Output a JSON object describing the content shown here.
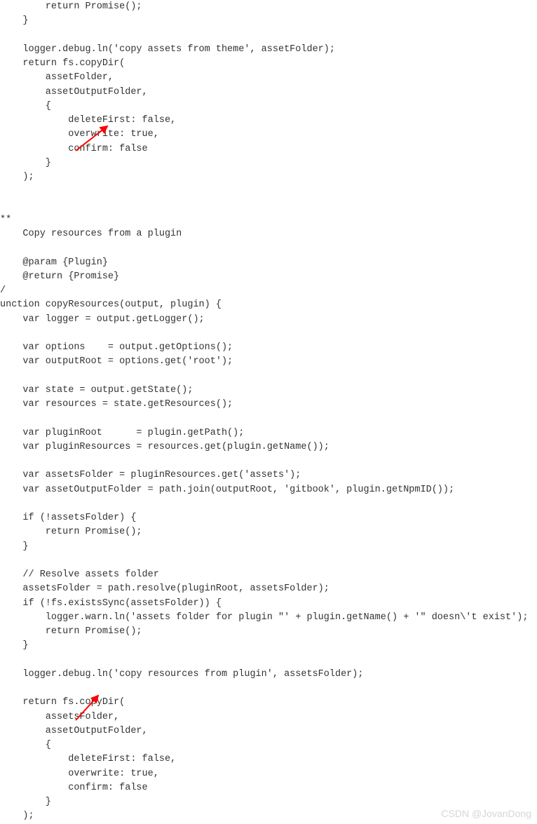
{
  "code": {
    "lines": [
      "        return Promise();",
      "    }",
      "",
      "    logger.debug.ln('copy assets from theme', assetFolder);",
      "    return fs.copyDir(",
      "        assetFolder,",
      "        assetOutputFolder,",
      "        {",
      "            deleteFirst: false,",
      "            overwrite: true,",
      "            confirm: false",
      "        }",
      "    );",
      "",
      "",
      "**",
      "    Copy resources from a plugin",
      "",
      "    @param {Plugin}",
      "    @return {Promise}",
      "/",
      "unction copyResources(output, plugin) {",
      "    var logger = output.getLogger();",
      "",
      "    var options    = output.getOptions();",
      "    var outputRoot = options.get('root');",
      "",
      "    var state = output.getState();",
      "    var resources = state.getResources();",
      "",
      "    var pluginRoot      = plugin.getPath();",
      "    var pluginResources = resources.get(plugin.getName());",
      "",
      "    var assetsFolder = pluginResources.get('assets');",
      "    var assetOutputFolder = path.join(outputRoot, 'gitbook', plugin.getNpmID());",
      "",
      "    if (!assetsFolder) {",
      "        return Promise();",
      "    }",
      "",
      "    // Resolve assets folder",
      "    assetsFolder = path.resolve(pluginRoot, assetsFolder);",
      "    if (!fs.existsSync(assetsFolder)) {",
      "        logger.warn.ln('assets folder for plugin \"' + plugin.getName() + '\" doesn\\'t exist');",
      "        return Promise();",
      "    }",
      "",
      "    logger.debug.ln('copy resources from plugin', assetsFolder);",
      "",
      "    return fs.copyDir(",
      "        assetsFolder,",
      "        assetOutputFolder,",
      "        {",
      "            deleteFirst: false,",
      "            overwrite: true,",
      "            confirm: false",
      "        }",
      "    );"
    ]
  },
  "watermark": "CSDN @JovanDong",
  "arrow_color": "#ff0000"
}
